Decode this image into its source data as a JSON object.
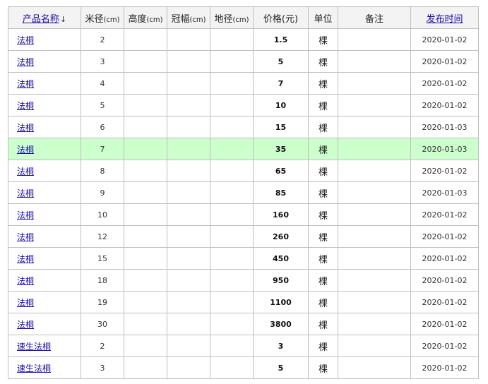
{
  "header": {
    "product_name": "产品名称",
    "sort_arrow": "↓",
    "diameter": "米径",
    "height": "高度",
    "crown": "冠幅",
    "ground_diameter": "地径",
    "price": "价格",
    "unit": "单位",
    "note": "备注",
    "publish_time": "发布时间",
    "unit_cm": "(cm)",
    "unit_yuan": "(元)"
  },
  "rows": [
    {
      "name": "法桐",
      "diameter": "2",
      "height": "",
      "crown": "",
      "ground": "",
      "price": "1.5",
      "unit": "棵",
      "note": "",
      "date": "2020-01-02"
    },
    {
      "name": "法桐",
      "diameter": "3",
      "height": "",
      "crown": "",
      "ground": "",
      "price": "5",
      "unit": "棵",
      "note": "",
      "date": "2020-01-02"
    },
    {
      "name": "法桐",
      "diameter": "4",
      "height": "",
      "crown": "",
      "ground": "",
      "price": "7",
      "unit": "棵",
      "note": "",
      "date": "2020-01-02"
    },
    {
      "name": "法桐",
      "diameter": "5",
      "height": "",
      "crown": "",
      "ground": "",
      "price": "10",
      "unit": "棵",
      "note": "",
      "date": "2020-01-02"
    },
    {
      "name": "法桐",
      "diameter": "6",
      "height": "",
      "crown": "",
      "ground": "",
      "price": "15",
      "unit": "棵",
      "note": "",
      "date": "2020-01-03"
    },
    {
      "name": "法桐",
      "diameter": "7",
      "height": "",
      "crown": "",
      "ground": "",
      "price": "35",
      "unit": "棵",
      "note": "",
      "date": "2020-01-03"
    },
    {
      "name": "法桐",
      "diameter": "8",
      "height": "",
      "crown": "",
      "ground": "",
      "price": "65",
      "unit": "棵",
      "note": "",
      "date": "2020-01-02"
    },
    {
      "name": "法桐",
      "diameter": "9",
      "height": "",
      "crown": "",
      "ground": "",
      "price": "85",
      "unit": "棵",
      "note": "",
      "date": "2020-01-03"
    },
    {
      "name": "法桐",
      "diameter": "10",
      "height": "",
      "crown": "",
      "ground": "",
      "price": "160",
      "unit": "棵",
      "note": "",
      "date": "2020-01-02"
    },
    {
      "name": "法桐",
      "diameter": "12",
      "height": "",
      "crown": "",
      "ground": "",
      "price": "260",
      "unit": "棵",
      "note": "",
      "date": "2020-01-02"
    },
    {
      "name": "法桐",
      "diameter": "15",
      "height": "",
      "crown": "",
      "ground": "",
      "price": "450",
      "unit": "棵",
      "note": "",
      "date": "2020-01-02"
    },
    {
      "name": "法桐",
      "diameter": "18",
      "height": "",
      "crown": "",
      "ground": "",
      "price": "950",
      "unit": "棵",
      "note": "",
      "date": "2020-01-02"
    },
    {
      "name": "法桐",
      "diameter": "19",
      "height": "",
      "crown": "",
      "ground": "",
      "price": "1100",
      "unit": "棵",
      "note": "",
      "date": "2020-01-02"
    },
    {
      "name": "法桐",
      "diameter": "30",
      "height": "",
      "crown": "",
      "ground": "",
      "price": "3800",
      "unit": "棵",
      "note": "",
      "date": "2020-01-02"
    },
    {
      "name": "速生法桐",
      "diameter": "2",
      "height": "",
      "crown": "",
      "ground": "",
      "price": "3",
      "unit": "棵",
      "note": "",
      "date": "2020-01-02"
    },
    {
      "name": "速生法桐",
      "diameter": "3",
      "height": "",
      "crown": "",
      "ground": "",
      "price": "5",
      "unit": "棵",
      "note": "",
      "date": "2020-01-02"
    }
  ],
  "highlighted_row_index": 5,
  "colors": {
    "link": "#1a0dab",
    "highlight_row": "#ccffcc",
    "header_bg": "#f3f3f3",
    "border": "#bfbfbf"
  }
}
